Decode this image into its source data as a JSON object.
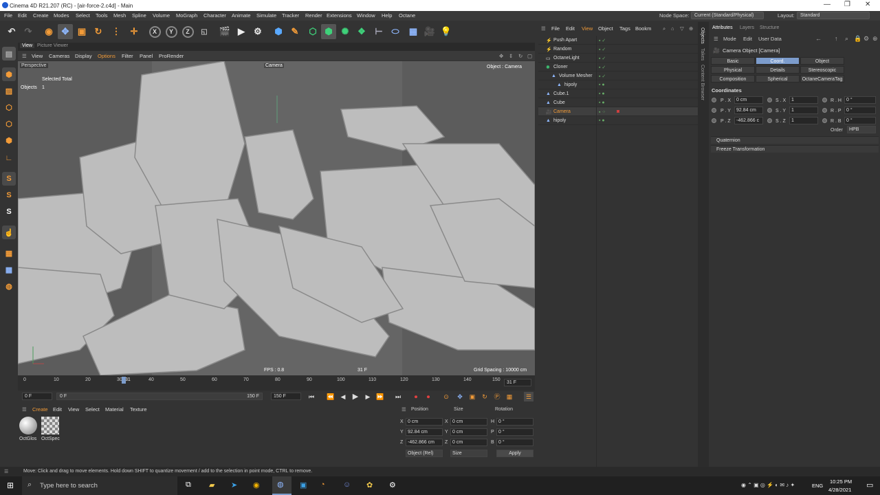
{
  "window": {
    "title": "Cinema 4D R21.207 (RC) - [air-force-2.c4d] - Main"
  },
  "menubar": {
    "items": [
      "File",
      "Edit",
      "Create",
      "Modes",
      "Select",
      "Tools",
      "Mesh",
      "Spline",
      "Volume",
      "MoGraph",
      "Character",
      "Animate",
      "Simulate",
      "Tracker",
      "Render",
      "Extensions",
      "Window",
      "Help",
      "Octane"
    ],
    "node_space_label": "Node Space:",
    "node_space_value": "Current (Standard/Physical)",
    "layout_label": "Layout:",
    "layout_value": "Standard"
  },
  "viewport": {
    "tabs": [
      "View",
      "Picture Viewer"
    ],
    "menu": [
      "View",
      "Cameras",
      "Display",
      "Options",
      "Filter",
      "Panel",
      "ProRender"
    ],
    "name": "Perspective",
    "camera": "Camera",
    "object_label": "Object : Camera",
    "stats_header": "Selected Total",
    "stats_row_label": "Objects",
    "stats_row_value": "1",
    "fps": "FPS : 0.8",
    "frame": "31 F",
    "grid_spacing": "Grid Spacing : 10000 cm"
  },
  "timeline": {
    "ticks": [
      "0",
      "10",
      "20",
      "30",
      "31",
      "40",
      "50",
      "60",
      "70",
      "80",
      "90",
      "100",
      "110",
      "120",
      "130",
      "140",
      "150"
    ],
    "current_frame": "31 F",
    "start_field": "0 F",
    "slider_start": "0 F",
    "slider_end": "150 F",
    "end_field": "150 F",
    "playhead_fraction": 0.207
  },
  "material_manager": {
    "menu": [
      "Create",
      "Edit",
      "View",
      "Select",
      "Material",
      "Texture"
    ],
    "materials": [
      {
        "name": "OctGlos"
      },
      {
        "name": "OctSpec"
      }
    ]
  },
  "coord_manager": {
    "headers": [
      "Position",
      "Size",
      "Rotation"
    ],
    "rows": [
      {
        "axis": "X",
        "pos": "0 cm",
        "saxis": "X",
        "size": "0 cm",
        "raxis": "H",
        "rot": "0 °"
      },
      {
        "axis": "Y",
        "pos": "92.84 cm",
        "saxis": "Y",
        "size": "0 cm",
        "raxis": "P",
        "rot": "0 °"
      },
      {
        "axis": "Z",
        "pos": "-462.866 cm",
        "saxis": "Z",
        "size": "0 cm",
        "raxis": "B",
        "rot": "0 °"
      }
    ],
    "mode": "Object (Rel)",
    "size_mode": "Size",
    "apply": "Apply"
  },
  "object_manager": {
    "menu": [
      "File",
      "Edit",
      "View",
      "Object",
      "Tags",
      "Bookm"
    ],
    "objects": [
      {
        "name": "Push Apart",
        "indent": 0
      },
      {
        "name": "Random",
        "indent": 0
      },
      {
        "name": "OctaneLight",
        "indent": 0
      },
      {
        "name": "Cloner",
        "indent": 0
      },
      {
        "name": "Volume Mesher",
        "indent": 1
      },
      {
        "name": "hipoly",
        "indent": 2
      },
      {
        "name": "Cube.1",
        "indent": 0
      },
      {
        "name": "Cube",
        "indent": 0
      },
      {
        "name": "Camera",
        "indent": 0
      },
      {
        "name": "hipoly",
        "indent": 0
      }
    ],
    "selected": "Camera"
  },
  "side_tabs": [
    "Objects",
    "Takes",
    "Content Browser"
  ],
  "attributes": {
    "tabs": [
      "Attributes",
      "Layers",
      "Structure"
    ],
    "menu": [
      "Mode",
      "Edit",
      "User Data"
    ],
    "object_title": "Camera Object [Camera]",
    "subtabs": [
      "Basic",
      "Coord.",
      "Object",
      "Physical",
      "Details",
      "Stereoscopic",
      "Composition",
      "Spherical",
      "OctaneCameraTag"
    ],
    "active_subtab": "Coord.",
    "section": "Coordinates",
    "coords": [
      {
        "p": "P . X",
        "pv": "0 cm",
        "s": "S . X",
        "sv": "1",
        "r": "R . H",
        "rv": "0 °"
      },
      {
        "p": "P . Y",
        "pv": "92.84 cm",
        "s": "S . Y",
        "sv": "1",
        "r": "R . P",
        "rv": "0 °"
      },
      {
        "p": "P . Z",
        "pv": "-462.866 c",
        "s": "S . Z",
        "sv": "1",
        "r": "R . B",
        "rv": "0 °"
      }
    ],
    "order_label": "Order",
    "order_value": "HPB",
    "groups": [
      "Quaternion",
      "Freeze Transformation"
    ]
  },
  "status": "Move: Click and drag to move elements. Hold down SHIFT to quantize movement / add to the selection in point mode, CTRL to remove.",
  "taskbar": {
    "search_placeholder": "Type here to search",
    "lang": "ENG",
    "time": "10:25 PM",
    "date": "4/28/2021"
  },
  "colors": {
    "accent": "#7c9ccc",
    "selected_text": "#f29b38",
    "titlebar": "#ffffff",
    "taskbar": "#202020"
  }
}
